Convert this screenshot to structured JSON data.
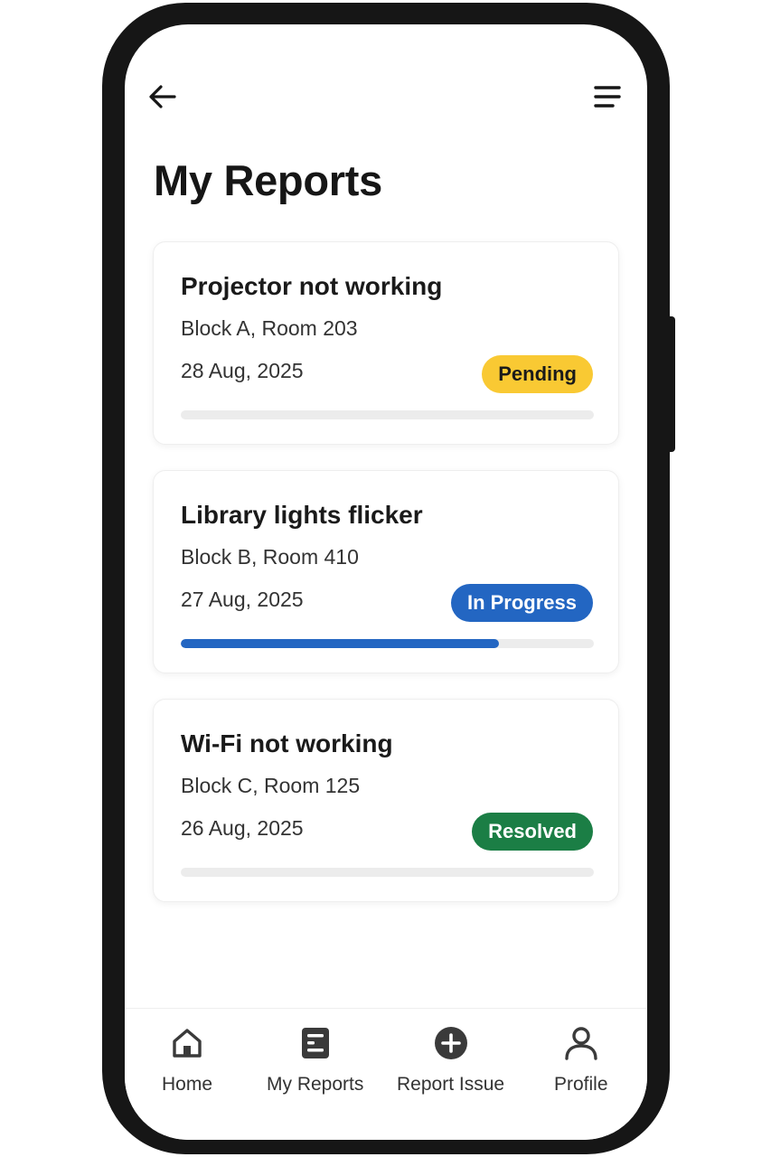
{
  "header": {
    "back_icon": "arrow-left-icon",
    "menu_icon": "hamburger-menu-icon",
    "title": "My Reports"
  },
  "reports": [
    {
      "title": "Projector not working",
      "location": "Block A, Room 203",
      "date": "28 Aug, 2025",
      "status": "Pending",
      "status_bg": "#F9C933",
      "status_fg": "#1a1a1a",
      "progress": 0,
      "progress_color": "#2366C2"
    },
    {
      "title": "Library lights flicker",
      "location": "Block B, Room 410",
      "date": "27 Aug, 2025",
      "status": "In Progress",
      "status_bg": "#2366C2",
      "status_fg": "#ffffff",
      "progress": 0.77,
      "progress_color": "#2366C2"
    },
    {
      "title": "Wi-Fi not working",
      "location": "Block C, Room 125",
      "date": "26 Aug, 2025",
      "status": "Resolved",
      "status_bg": "#1B7E45",
      "status_fg": "#ffffff",
      "progress": 0,
      "progress_color": "#1B7E45"
    }
  ],
  "nav": {
    "items": [
      {
        "label": "Home",
        "icon": "home-icon"
      },
      {
        "label": "My Reports",
        "icon": "reports-icon"
      },
      {
        "label": "Report Issue",
        "icon": "plus-circle-icon"
      },
      {
        "label": "Profile",
        "icon": "profile-icon"
      }
    ]
  }
}
